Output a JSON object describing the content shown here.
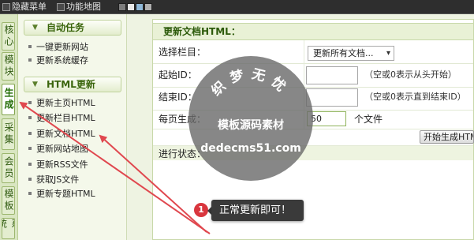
{
  "topbar": {
    "hide_menu": "隐藏菜单",
    "function_map": "功能地图",
    "swatches": [
      "#7d7d7d",
      "#e9e9e9",
      "#8fb8d8",
      "#b0b0b0"
    ]
  },
  "tabs": [
    {
      "label": "核心"
    },
    {
      "label": "模块"
    },
    {
      "label": "生成",
      "active": true
    },
    {
      "label": "采集"
    },
    {
      "label": "会员"
    },
    {
      "label": "模板"
    },
    {
      "label": "系统"
    }
  ],
  "menu": {
    "groups": [
      {
        "title": "自动任务",
        "items": [
          "一键更新网站",
          "更新系统缓存"
        ]
      },
      {
        "title": "HTML更新",
        "items": [
          "更新主页HTML",
          "更新栏目HTML",
          "更新文档HTML",
          "更新网站地图",
          "更新RSS文件",
          "获取JS文件",
          "更新专题HTML"
        ]
      }
    ]
  },
  "main": {
    "title": "更新文档HTML：",
    "category": {
      "label": "选择栏目：",
      "selected": "更新所有文档..."
    },
    "start_id": {
      "label": "起始ID：",
      "hint": "（空或0表示从头开始）"
    },
    "end_id": {
      "label": "结束ID：",
      "hint": "（空或0表示直到结束ID）"
    },
    "per_page": {
      "label": "每页生成：",
      "value": "50",
      "unit": "个文件"
    },
    "start_button": "开始生成HTML",
    "status": {
      "label": "进行状态："
    }
  },
  "watermark": {
    "brand": "织梦无忧",
    "tagline": "模板源码素材",
    "site": "dedecms51.com"
  },
  "callout": {
    "number": "1",
    "text": "正常更新即可！"
  },
  "colors": {
    "accent_green": "#3a650c",
    "arrow_red": "#e0484f",
    "callout_red": "#d9363e",
    "watermark_fill": "rgba(105,105,105,0.8)"
  }
}
